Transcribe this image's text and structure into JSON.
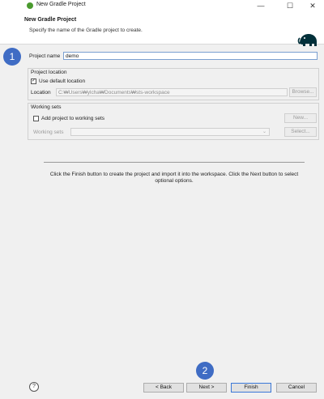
{
  "window": {
    "title": "New Gradle Project",
    "controls": {
      "minimize": "—",
      "maximize": "☐",
      "close": "✕"
    }
  },
  "header": {
    "title": "New Gradle Project",
    "description": "Specify the name of the Gradle project to create."
  },
  "badges": {
    "first": "1",
    "second": "2"
  },
  "project_name": {
    "label": "Project name",
    "value": "demo"
  },
  "project_location": {
    "group_label": "Project location",
    "use_default_label": "Use default location",
    "use_default_checked": "✓",
    "location_label": "Location",
    "location_value": "C:₩Users₩ylcha₩Documents₩sts-workspace",
    "browse_label": "Browse..."
  },
  "working_sets": {
    "group_label": "Working sets",
    "add_label": "Add project to working sets",
    "new_label": "New...",
    "sets_label": "Working sets",
    "select_label": "Select...",
    "combo_arrow": "⌄"
  },
  "info_text": "Click the Finish button to create the project and import it into the workspace. Click the Next button to select optional options.",
  "footer": {
    "help": "?",
    "back_label": "< Back",
    "next_label": "Next >",
    "finish_label": "Finish",
    "cancel_label": "Cancel"
  },
  "colors": {
    "accent": "#3f6cc4",
    "gradle_icon": "#02303a",
    "app_icon": "#4a9a2e"
  },
  "icons": {
    "app": "eclipse-sts-icon",
    "gradle": "gradle-elephant-icon",
    "help": "help-icon"
  }
}
